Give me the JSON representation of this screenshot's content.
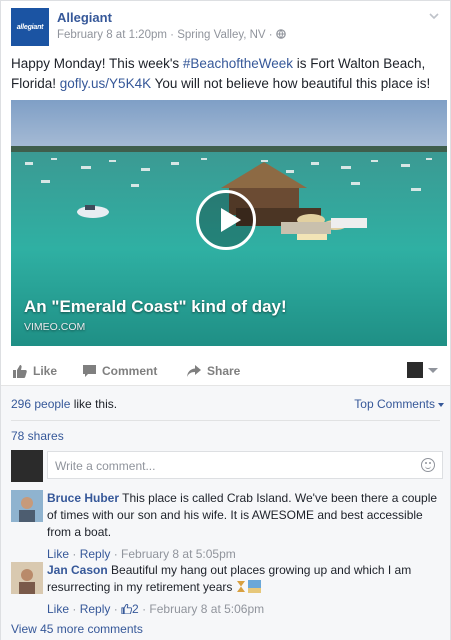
{
  "post": {
    "page_name": "Allegiant",
    "logo_text": "allegiant",
    "date": "February 8 at 1:20pm",
    "location": "Spring Valley, NV",
    "separator": " · ",
    "text_part1": "Happy Monday! This week's ",
    "hashtag": "#BeachoftheWeek",
    "text_part2": " is Fort Walton Beach, Florida! ",
    "link": "gofly.us/Y5K4K",
    "text_part3": " You will not believe how beautiful this place is!"
  },
  "video": {
    "title": "An \"Emerald Coast\" kind of day!",
    "source": "VIMEO.COM"
  },
  "actions": {
    "like": "Like",
    "comment": "Comment",
    "share": "Share"
  },
  "ufi": {
    "likes_link": "296 people",
    "likes_suffix": " like this.",
    "top_comments": "Top Comments",
    "shares": "78 shares",
    "composer_placeholder": "Write a comment...",
    "view_more": "View 45 more comments"
  },
  "comments": [
    {
      "name": "Bruce Huber",
      "text": " This place is called Crab Island. We've been there a couple of times with our son and his wife. It is AWESOME and best accessible from a boat.",
      "like": "Like",
      "reply": "Reply",
      "time": "February 8 at 5:05pm"
    },
    {
      "name": "Jan Cason",
      "text": " Beautiful my hang out places growing up and which I am resurrecting in my retirement years ",
      "like": "Like",
      "reply": "Reply",
      "like_count": "2",
      "time": "February 8 at 5:06pm"
    }
  ],
  "colors": {
    "link_blue": "#365899",
    "meta_gray": "#90949c",
    "logo_blue": "#1b54a3",
    "water_teal": "#2fa69c"
  },
  "icons": [
    "chevron-down-icon",
    "globe-icon",
    "thumbs-up-icon",
    "comment-icon",
    "share-icon",
    "play-icon",
    "smiley-icon"
  ]
}
